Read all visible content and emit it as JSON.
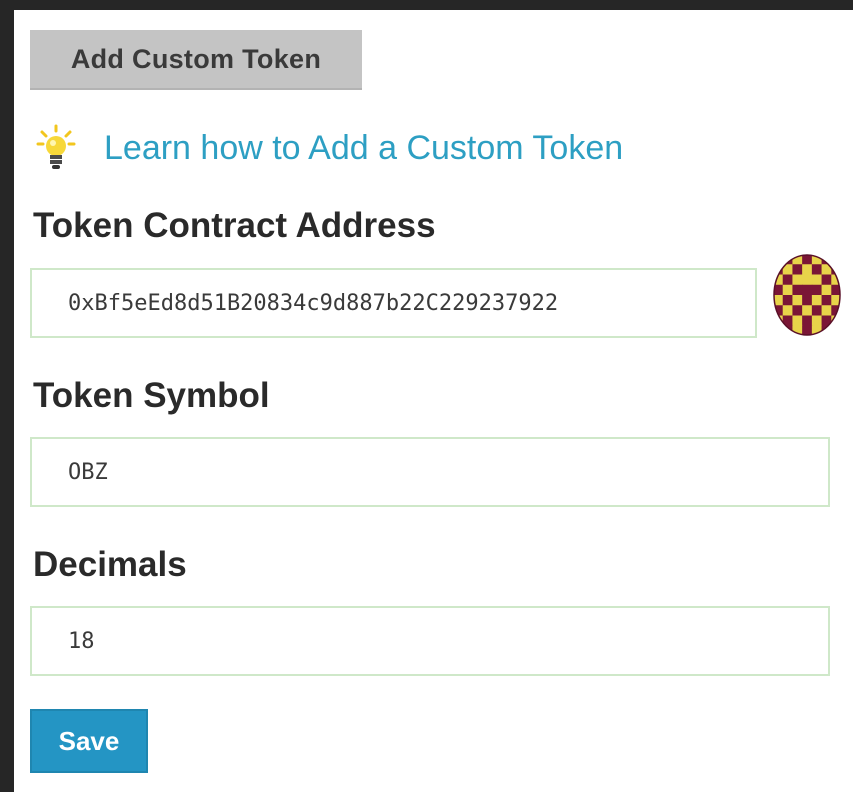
{
  "header": {
    "tab_label": "Add Custom Token"
  },
  "help": {
    "icon": "lightbulb-icon",
    "link_text": "Learn how to Add a Custom Token"
  },
  "form": {
    "address": {
      "label": "Token Contract Address",
      "value": "0xBf5eEd8d51B20834c9d887b22C229237922"
    },
    "symbol": {
      "label": "Token Symbol",
      "value": "OBZ"
    },
    "decimals": {
      "label": "Decimals",
      "value": "18"
    },
    "identicon": "identicon-avatar",
    "save_label": "Save"
  },
  "colors": {
    "page_border": "#262626",
    "tab_background": "#c4c4c4",
    "link": "#2d9fc3",
    "input_border": "#cfe8c9",
    "save_button": "#2495c4",
    "identicon_primary": "#e8d44a",
    "identicon_secondary": "#7a1636"
  }
}
